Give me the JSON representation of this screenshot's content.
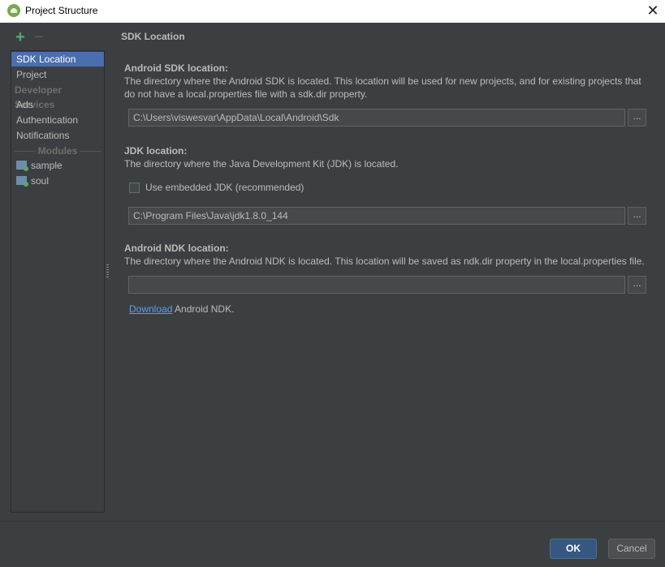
{
  "window": {
    "title": "Project Structure"
  },
  "toolbar": {
    "add_icon": "plus-icon",
    "remove_icon": "minus-icon"
  },
  "sidebar": {
    "items": [
      {
        "label": "SDK Location",
        "selected": true
      },
      {
        "label": "Project"
      }
    ],
    "group_developer_services": "Developer Services",
    "services": [
      {
        "label": "Ads"
      },
      {
        "label": "Authentication"
      },
      {
        "label": "Notifications"
      }
    ],
    "group_modules": "Modules",
    "modules": [
      {
        "label": "sample",
        "icon": "module-icon"
      },
      {
        "label": "soul",
        "icon": "module-icon"
      }
    ]
  },
  "panel": {
    "title": "SDK Location",
    "android_sdk": {
      "heading": "Android SDK location:",
      "description": "The directory where the Android SDK is located. This location will be used for new projects, and for existing projects that do not have a local.properties file with a sdk.dir property.",
      "value": "C:\\Users\\viswesvar\\AppData\\Local\\Android\\Sdk",
      "browse_label": "..."
    },
    "jdk": {
      "heading": "JDK location:",
      "description": "The directory where the Java Development Kit (JDK) is located.",
      "embedded_label": "Use embedded JDK (recommended)",
      "embedded_checked": false,
      "value": "C:\\Program Files\\Java\\jdk1.8.0_144",
      "browse_label": "..."
    },
    "ndk": {
      "heading": "Android NDK location:",
      "description": "The directory where the Android NDK is located. This location will be saved as ndk.dir property in the local.properties file.",
      "value": "",
      "browse_label": "...",
      "download_link": "Download",
      "download_suffix": " Android NDK."
    }
  },
  "footer": {
    "ok_label": "OK",
    "cancel_label": "Cancel"
  },
  "colors": {
    "background": "#3c3f41",
    "selection": "#4b6eaf",
    "link": "#589df6",
    "ok_button": "#365880",
    "add_green": "#59a869"
  }
}
